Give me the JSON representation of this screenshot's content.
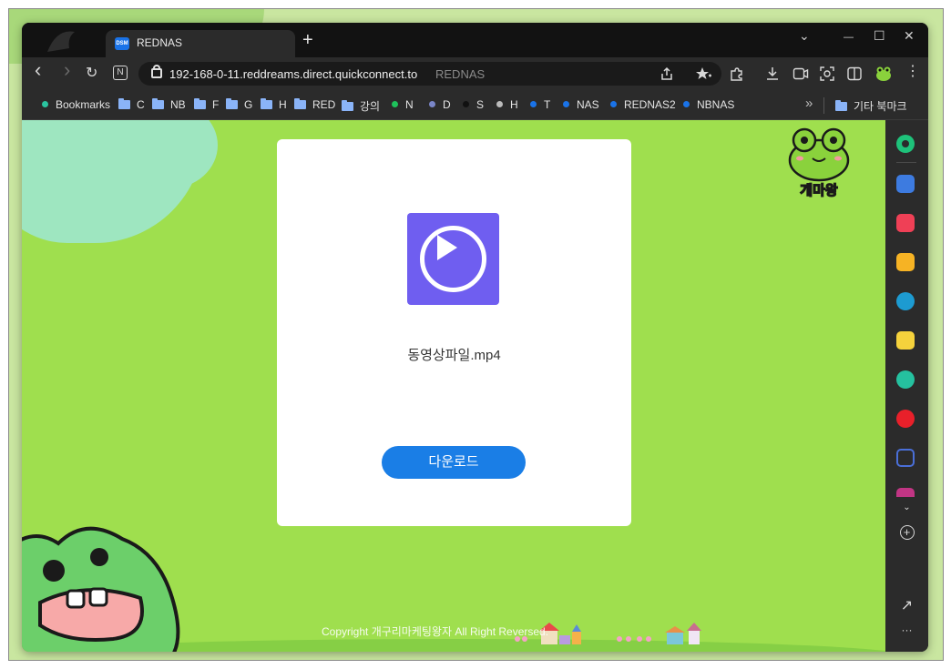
{
  "browser": {
    "tab": {
      "favicon_text": "DSM",
      "title": "REDNAS"
    },
    "new_tab_label": "+",
    "window_controls": {
      "tab_search": "⌄",
      "minimize": "—",
      "maximize": "☐",
      "close": "✕"
    },
    "nav": {
      "back": "‹",
      "forward": "›",
      "reload": "↻",
      "notion": "N"
    },
    "address": {
      "host": "192-168-0-11.reddreams.direct.quickconnect.to",
      "page_title": "REDNAS"
    },
    "toolbar_icons": [
      "share-icon",
      "favorites-icon",
      "extensions-icon",
      "download-icon",
      "screencast-icon",
      "capture-icon",
      "split-view-icon",
      "profile-frog-icon",
      "more-icon"
    ]
  },
  "bookmarks": [
    {
      "label": "Bookmarks",
      "kind": "dot",
      "color": "#2bc4a0"
    },
    {
      "label": "C",
      "kind": "folder"
    },
    {
      "label": "NB",
      "kind": "folder"
    },
    {
      "label": "F",
      "kind": "folder"
    },
    {
      "label": "G",
      "kind": "folder"
    },
    {
      "label": "H",
      "kind": "folder"
    },
    {
      "label": "RED",
      "kind": "folder"
    },
    {
      "label": "강의",
      "kind": "folder"
    },
    {
      "label": "N",
      "kind": "dot",
      "color": "#1ec25b"
    },
    {
      "label": "D",
      "kind": "dot",
      "color": "#7a86c8"
    },
    {
      "label": "S",
      "kind": "dot",
      "color": "#111111"
    },
    {
      "label": "H",
      "kind": "dot",
      "color": "#bbbbbb"
    },
    {
      "label": "T",
      "kind": "dot",
      "color": "#1a73e8"
    },
    {
      "label": "NAS",
      "kind": "dot",
      "color": "#1a73e8"
    },
    {
      "label": "REDNAS2",
      "kind": "dot",
      "color": "#1a73e8"
    },
    {
      "label": "NBNAS",
      "kind": "dot",
      "color": "#1a73e8"
    }
  ],
  "bookmarks_overflow": "»",
  "other_bookmarks": "기타 북마크",
  "page": {
    "file_name": "동영상파일.mp4",
    "download_button": "다운로드",
    "copyright": "Copyright 개구리마케팅왕자 All Right Reversed.",
    "logo_text": "개마왕"
  },
  "sidebar": {
    "items": [
      {
        "name": "sidebar-copilot-icon",
        "color": "#1ec27a"
      },
      {
        "name": "sidebar-tools-icon",
        "color": "#3d7be0"
      },
      {
        "name": "sidebar-pocket-icon",
        "color": "#ef4056"
      },
      {
        "name": "sidebar-favorites-icon",
        "color": "#f6b324"
      },
      {
        "name": "sidebar-edge-drop-icon",
        "color": "#1d9bd1"
      },
      {
        "name": "sidebar-notes-icon",
        "color": "#f5d23c"
      },
      {
        "name": "sidebar-player-icon",
        "color": "#25c19f"
      },
      {
        "name": "sidebar-music-icon",
        "color": "#e8202a"
      },
      {
        "name": "sidebar-edit-icon",
        "color": "#4a6fd8"
      },
      {
        "name": "sidebar-instagram-icon",
        "color": "#c13584"
      }
    ],
    "expand": "⌄",
    "add": "+",
    "open_external": "↗",
    "more": "···"
  },
  "colors": {
    "page_bg": "#9fdf4e",
    "accent_button": "#1a7ee6",
    "video_thumb": "#6f5ef0"
  }
}
